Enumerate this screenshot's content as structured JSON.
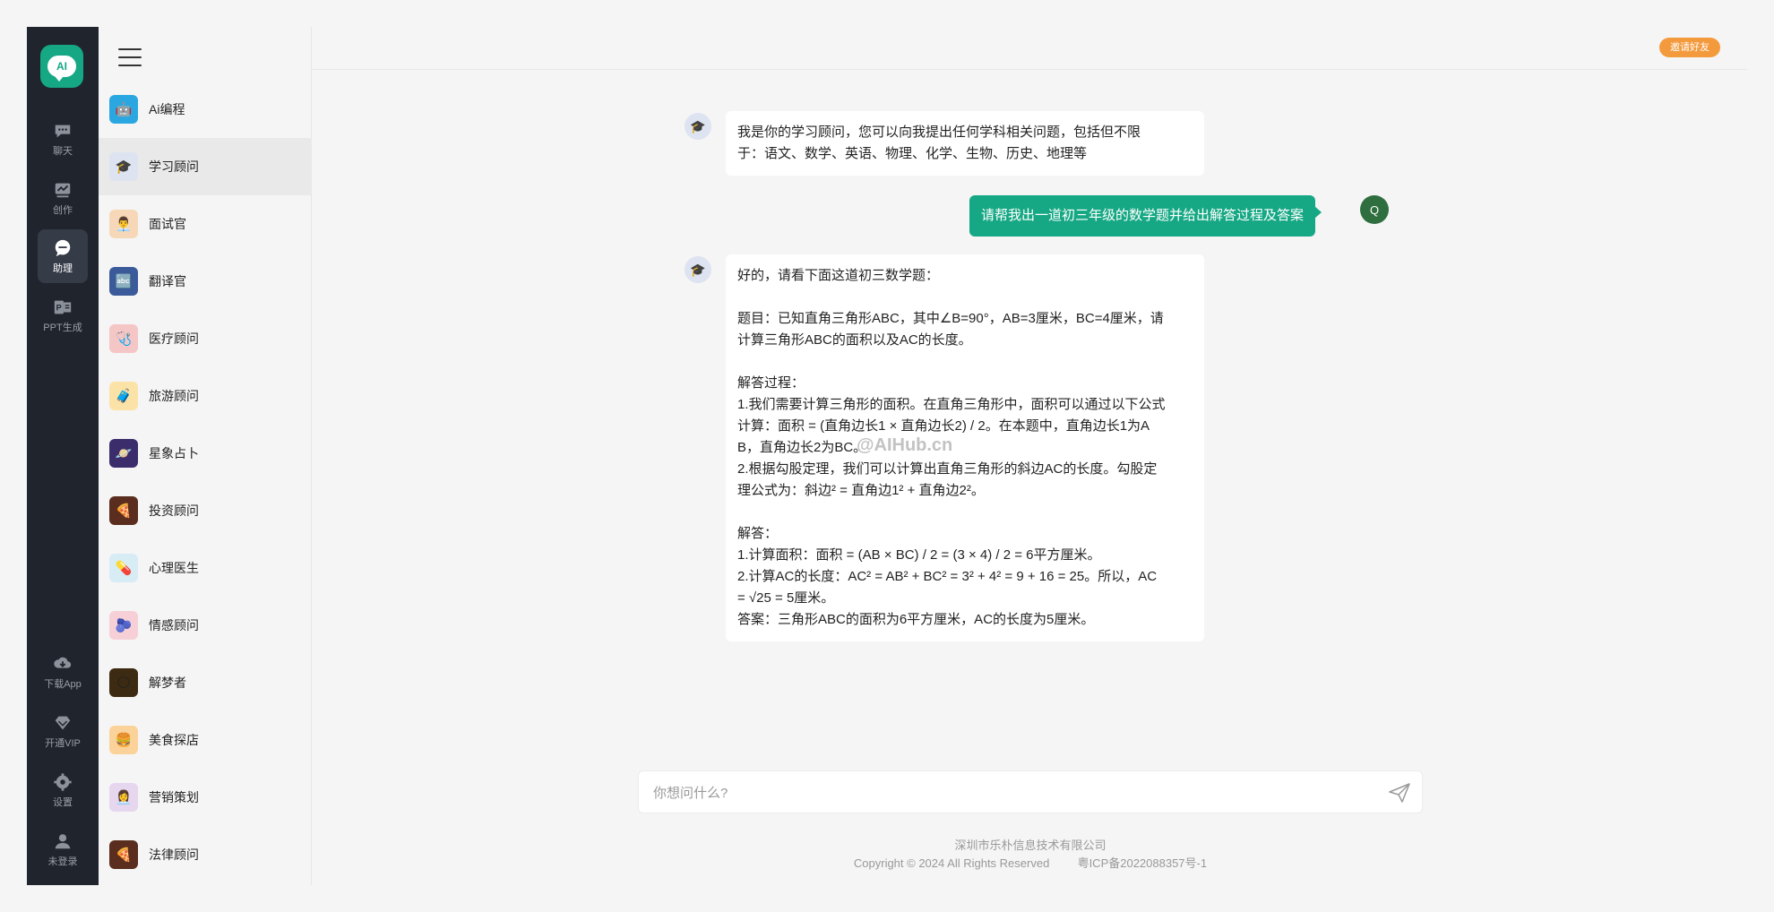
{
  "rail": {
    "logo_text": "AI",
    "items": [
      {
        "label": "聊天",
        "icon": "chat-icon"
      },
      {
        "label": "创作",
        "icon": "chart-icon"
      },
      {
        "label": "助理",
        "icon": "assistant-icon"
      },
      {
        "label": "PPT生成",
        "icon": "ppt-icon"
      }
    ],
    "bottom": [
      {
        "label": "下载App",
        "icon": "download-icon"
      },
      {
        "label": "开通VIP",
        "icon": "diamond-icon"
      },
      {
        "label": "设置",
        "icon": "gear-icon"
      },
      {
        "label": "未登录",
        "icon": "user-icon"
      }
    ]
  },
  "assistants": [
    {
      "label": "Ai编程",
      "emoji": "🤖",
      "bg": "#2aa7e0"
    },
    {
      "label": "学习顾问",
      "emoji": "🎓",
      "bg": "#dde3f0"
    },
    {
      "label": "面试官",
      "emoji": "👨‍💼",
      "bg": "#f6d8b8"
    },
    {
      "label": "翻译官",
      "emoji": "🔤",
      "bg": "#3a5a9a"
    },
    {
      "label": "医疗顾问",
      "emoji": "🩺",
      "bg": "#f5c6c6"
    },
    {
      "label": "旅游顾问",
      "emoji": "🧳",
      "bg": "#fbe3a8"
    },
    {
      "label": "星象占卜",
      "emoji": "🪐",
      "bg": "#3b2d6b"
    },
    {
      "label": "投资顾问",
      "emoji": "🍕",
      "bg": "#5a2d1f"
    },
    {
      "label": "心理医生",
      "emoji": "💊",
      "bg": "#d8ecf6"
    },
    {
      "label": "情感顾问",
      "emoji": "🫐",
      "bg": "#f6d0d6"
    },
    {
      "label": "解梦者",
      "emoji": "🌕",
      "bg": "#3d2a12"
    },
    {
      "label": "美食探店",
      "emoji": "🍔",
      "bg": "#fbd39a"
    },
    {
      "label": "营销策划",
      "emoji": "👩‍💼",
      "bg": "#e6d6ee"
    },
    {
      "label": "法律顾问",
      "emoji": "🍕",
      "bg": "#5a2d1f"
    }
  ],
  "topbar": {
    "invite_label": "邀请好友"
  },
  "chat": {
    "bot_intro": "我是你的学习顾问，您可以向我提出任何学科相关问题，包括但不限\n于：语文、数学、英语、物理、化学、生物、历史、地理等",
    "user_message": "请帮我出一道初三年级的数学题并给出解答过程及答案",
    "user_avatar": "Q",
    "bot_answer": "好的，请看下面这道初三数学题：\n\n题目：已知直角三角形ABC，其中∠B=90°，AB=3厘米，BC=4厘米，请\n计算三角形ABC的面积以及AC的长度。\n\n解答过程：\n1.我们需要计算三角形的面积。在直角三角形中，面积可以通过以下公式\n计算：面积 = (直角边长1 × 直角边长2) / 2。在本题中，直角边长1为A\nB，直角边长2为BC。\n2.根据勾股定理，我们可以计算出直角三角形的斜边AC的长度。勾股定\n理公式为：斜边² = 直角边1² + 直角边2²。\n\n解答：\n1.计算面积：面积 = (AB × BC) / 2 = (3 × 4) / 2 = 6平方厘米。\n2.计算AC的长度：AC² = AB² + BC² = 3² + 4² = 9 + 16 = 25。所以，AC\n= √25 = 5厘米。\n答案：三角形ABC的面积为6平方厘米，AC的长度为5厘米。",
    "watermark": "@AIHub.cn"
  },
  "input": {
    "placeholder": "你想问什么?"
  },
  "footer": {
    "company": "深圳市乐朴信息技术有限公司",
    "copyright": "Copyright © 2024 All Rights Reserved",
    "icp": "粤ICP备2022088357号-1"
  }
}
